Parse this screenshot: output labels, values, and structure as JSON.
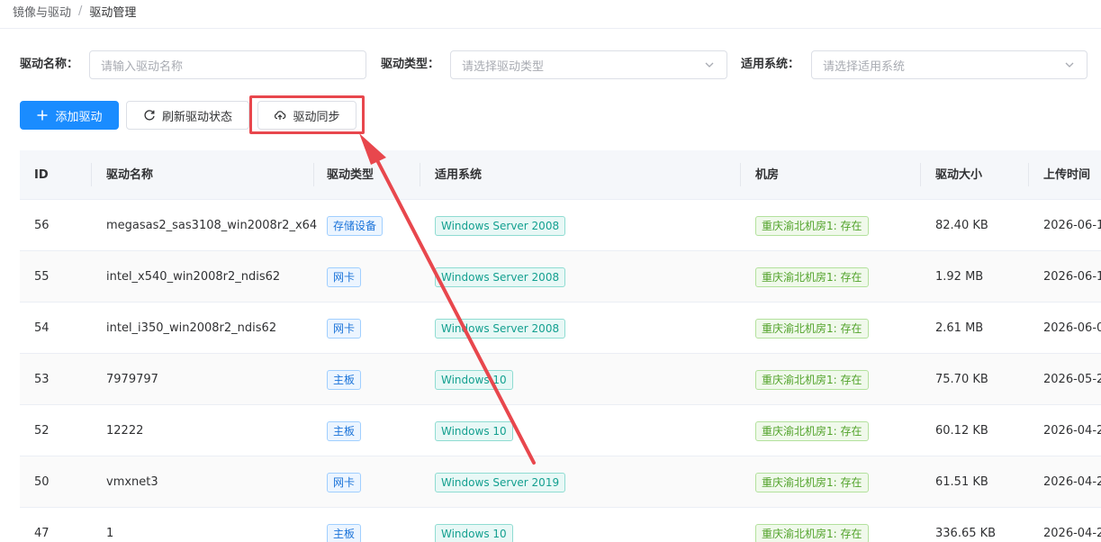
{
  "breadcrumb": {
    "parent": "镜像与驱动",
    "separator": "/",
    "current": "驱动管理"
  },
  "filters": {
    "name": {
      "label": "驱动名称：",
      "placeholder": "请输入驱动名称"
    },
    "type": {
      "label": "驱动类型：",
      "placeholder": "请选择驱动类型"
    },
    "os": {
      "label": "适用系统：",
      "placeholder": "请选择适用系统"
    }
  },
  "toolbar": {
    "add_label": "添加驱动",
    "refresh_label": "刷新驱动状态",
    "sync_label": "驱动同步"
  },
  "colors": {
    "primary": "#1a8cff",
    "highlight": "#e8474d"
  },
  "table": {
    "columns": [
      "ID",
      "驱动名称",
      "驱动类型",
      "适用系统",
      "机房",
      "驱动大小",
      "上传时间"
    ],
    "rows": [
      {
        "id": "56",
        "name": "megasas2_sas3108_win2008r2_x64",
        "type": "存储设备",
        "os": "Windows Server 2008",
        "room": "重庆渝北机房1: 存在",
        "size": "82.40 KB",
        "time": "2026-06-1"
      },
      {
        "id": "55",
        "name": "intel_x540_win2008r2_ndis62",
        "type": "网卡",
        "os": "Windows Server 2008",
        "room": "重庆渝北机房1: 存在",
        "size": "1.92 MB",
        "time": "2026-06-1"
      },
      {
        "id": "54",
        "name": "intel_i350_win2008r2_ndis62",
        "type": "网卡",
        "os": "Windows Server 2008",
        "room": "重庆渝北机房1: 存在",
        "size": "2.61 MB",
        "time": "2026-06-0"
      },
      {
        "id": "53",
        "name": "7979797",
        "type": "主板",
        "os": "Windows 10",
        "room": "重庆渝北机房1: 存在",
        "size": "75.70 KB",
        "time": "2026-05-2"
      },
      {
        "id": "52",
        "name": "12222",
        "type": "主板",
        "os": "Windows 10",
        "room": "重庆渝北机房1: 存在",
        "size": "60.12 KB",
        "time": "2026-04-2"
      },
      {
        "id": "50",
        "name": "vmxnet3",
        "type": "网卡",
        "os": "Windows Server 2019",
        "room": "重庆渝北机房1: 存在",
        "size": "61.51 KB",
        "time": "2026-04-2"
      },
      {
        "id": "47",
        "name": "1",
        "type": "主板",
        "os": "Windows 10",
        "room": "重庆渝北机房1: 存在",
        "size": "336.65 KB",
        "time": "2026-04-2"
      }
    ]
  }
}
